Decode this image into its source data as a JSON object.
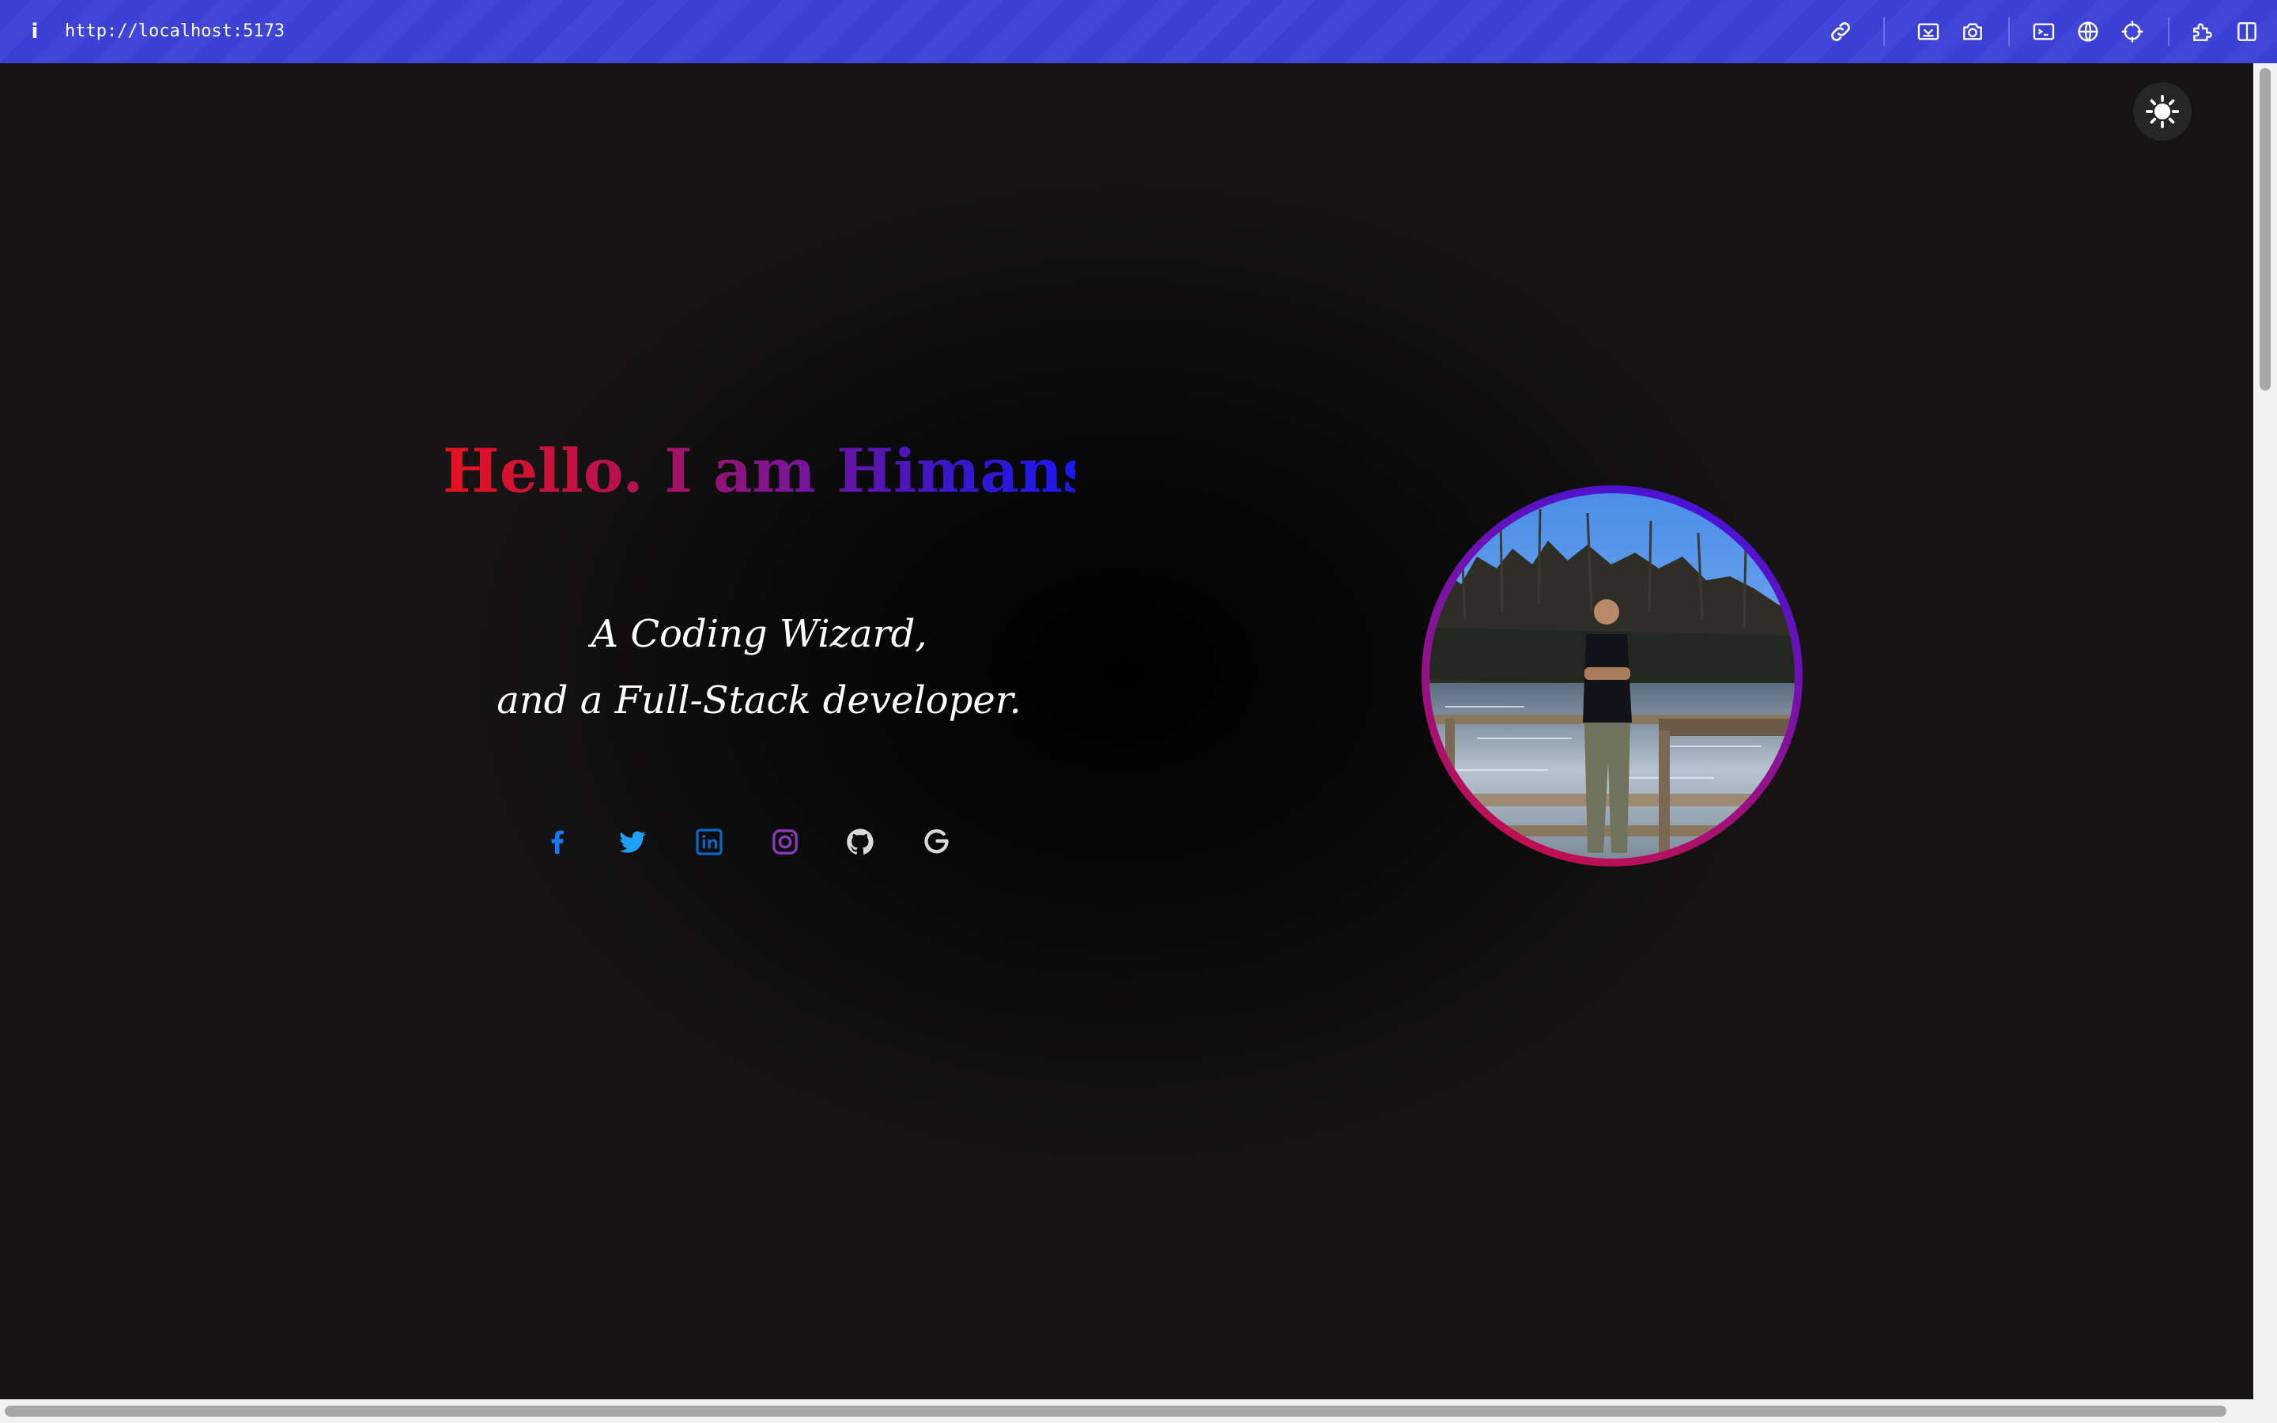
{
  "browser": {
    "url": "http://localhost:5173",
    "info_icon": "i",
    "toolbar_icons": [
      "link-icon",
      "screencast-icon",
      "camera-icon",
      "terminal-icon",
      "globe-icon",
      "crosshair-icon",
      "puzzle-icon",
      "split-view-icon"
    ]
  },
  "theme_toggle": {
    "icon": "sun-icon"
  },
  "hero": {
    "headline": "Hello. I am Himanshu,",
    "subtitle_line1": "A Coding Wizard,",
    "subtitle_line2": "and a Full-Stack developer.",
    "gradient_colors": [
      "#e8121e",
      "#7a1496",
      "#1a18f0"
    ]
  },
  "socials": [
    {
      "name": "facebook-icon",
      "color": "#1877f2"
    },
    {
      "name": "twitter-icon",
      "color": "#1da1f2"
    },
    {
      "name": "linkedin-icon",
      "color": "#0a66c2"
    },
    {
      "name": "instagram-icon",
      "color": "#8a3ab9"
    },
    {
      "name": "github-icon",
      "color": "#d9d9d9"
    },
    {
      "name": "google-icon",
      "color": "#d9d9d9"
    }
  ],
  "profile_photo": {
    "icon": "profile-photo"
  }
}
